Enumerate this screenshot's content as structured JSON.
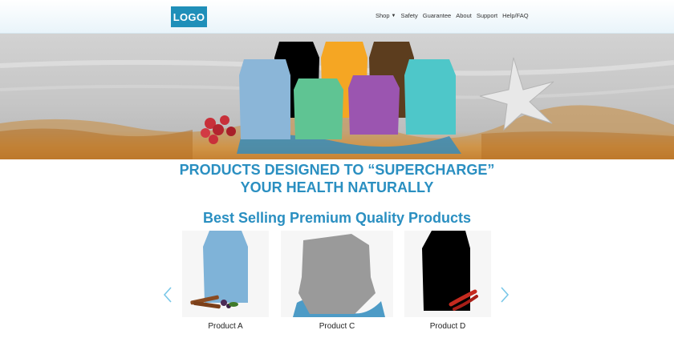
{
  "header": {
    "logo": "LOGO",
    "nav": [
      {
        "label": "Shop",
        "has_dropdown": true
      },
      {
        "label": "Safety"
      },
      {
        "label": "Guarantee"
      },
      {
        "label": "About"
      },
      {
        "label": "Support"
      },
      {
        "label": "Help/FAQ"
      }
    ]
  },
  "hero": {
    "bag_colors": [
      "#000000",
      "#f5a623",
      "#5c3d1e",
      "#8bb6d8",
      "#5fc493",
      "#9b55b0",
      "#4ec7c9"
    ]
  },
  "headline": {
    "line1": "PRODUCTS DESIGNED TO “SUPERCHARGE”",
    "line2": "YOUR HEALTH NATURALLY"
  },
  "section_title": "Best Selling Premium Quality Products",
  "products": [
    {
      "label": "Product A",
      "bag_color": "#7fb3d8"
    },
    {
      "label": "Product C",
      "bag_color": "#9a9a9a"
    },
    {
      "label": "Product D",
      "bag_color": "#000000"
    }
  ],
  "colors": {
    "accent": "#2a8fc1",
    "logo_bg": "#1f8fb9"
  }
}
